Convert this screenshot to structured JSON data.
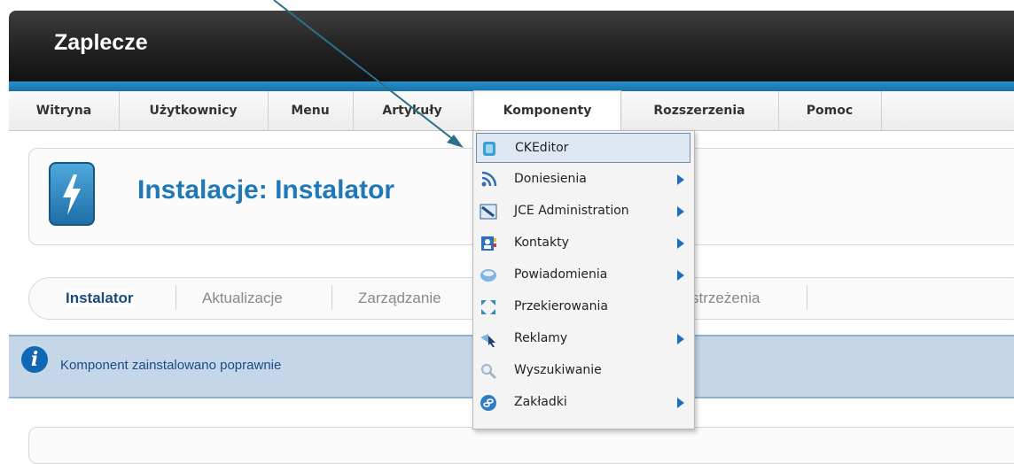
{
  "header": {
    "title": "Zaplecze"
  },
  "menu": {
    "items": [
      {
        "label": "Witryna"
      },
      {
        "label": "Użytkownicy"
      },
      {
        "label": "Menu"
      },
      {
        "label": "Artykuły"
      },
      {
        "label": "Komponenty",
        "active": true
      },
      {
        "label": "Rozszerzenia"
      },
      {
        "label": "Pomoc"
      }
    ]
  },
  "page": {
    "title": "Instalacje: Instalator"
  },
  "submenu": {
    "items": [
      {
        "label": "Instalator",
        "active": true
      },
      {
        "label": "Aktualizacje"
      },
      {
        "label": "Zarządzanie"
      },
      {
        "label": "strzeżenia"
      }
    ]
  },
  "message": {
    "text": "Komponent zainstalowano poprawnie"
  },
  "dropdown": {
    "items": [
      {
        "label": "CKEditor",
        "icon": "ckeditor-icon",
        "submenu": false,
        "highlighted": true
      },
      {
        "label": "Doniesienia",
        "icon": "rss-icon",
        "submenu": true
      },
      {
        "label": "JCE Administration",
        "icon": "jce-icon",
        "submenu": true
      },
      {
        "label": "Kontakty",
        "icon": "contacts-icon",
        "submenu": true
      },
      {
        "label": "Powiadomienia",
        "icon": "messages-icon",
        "submenu": true
      },
      {
        "label": "Przekierowania",
        "icon": "redirect-icon",
        "submenu": false
      },
      {
        "label": "Reklamy",
        "icon": "banners-icon",
        "submenu": true
      },
      {
        "label": "Wyszukiwanie",
        "icon": "search-icon",
        "submenu": false
      },
      {
        "label": "Zakładki",
        "icon": "weblinks-icon",
        "submenu": true
      }
    ]
  },
  "colors": {
    "accent": "#1f78b8",
    "header": "#1c1c1c",
    "band": "#1f7fba",
    "message_bg": "#c5d6e8"
  }
}
